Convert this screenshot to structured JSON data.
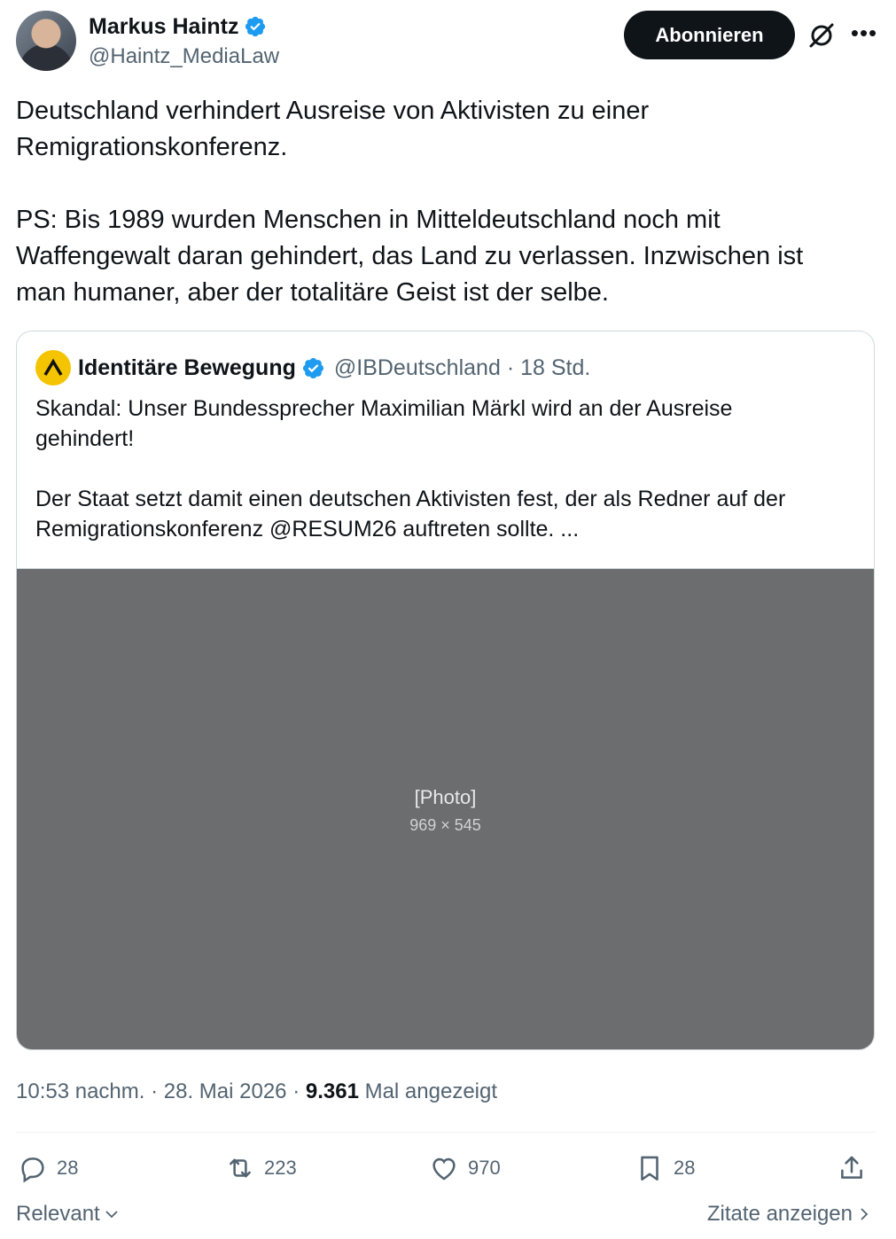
{
  "author": {
    "name": "Markus Haintz",
    "handle": "@Haintz_MediaLaw",
    "verified": true
  },
  "follow_button": {
    "label": "Abonnieren"
  },
  "icons": {
    "grok": "grok-icon",
    "more": "more-icon"
  },
  "post": {
    "paragraph1_line1": "Deutschland verhindert Ausreise von Aktivisten zu einer",
    "paragraph1_line2": "Remigrationskonferenz.",
    "paragraph2_line1": "PS: Bis 1989 wurden Menschen in Mitteldeutschland noch mit",
    "paragraph2_line2": "Waffengewalt daran gehindert, das Land zu verlassen. Inzwischen ist",
    "paragraph2_line3": "man humaner, aber der totalitäre Geist ist der selbe."
  },
  "quote": {
    "name": "Identitäre Bewegung",
    "handle": "@IBDeutschland",
    "time": "· 18 Std.",
    "text1_line1": "Skandal: Unser Bundessprecher Maximilian Märkl wird an der Ausreise",
    "text1_line2": "gehindert!",
    "text2_line1": "Der Staat setzt damit einen deutschen Aktivisten fest, der als Redner auf der",
    "text2_line2": "Remigrationskonferenz @RESUM26 auftreten sollte. ..."
  },
  "meta": {
    "time": "10:53 nachm. · 28. Mai 2026 · ",
    "views_count": "9.361",
    "views_label": " Mal angezeigt"
  },
  "actions": {
    "replies": "28",
    "reposts": "223",
    "likes": "970",
    "bookmarks": "28"
  },
  "footer": {
    "sort_label": "Relevant",
    "quotes_label": "Zitate anzeigen"
  },
  "colors": {
    "text": "#0f1419",
    "secondary": "#536471",
    "verified": "#1d9bf0",
    "quote_avatar": "#f5c400"
  }
}
